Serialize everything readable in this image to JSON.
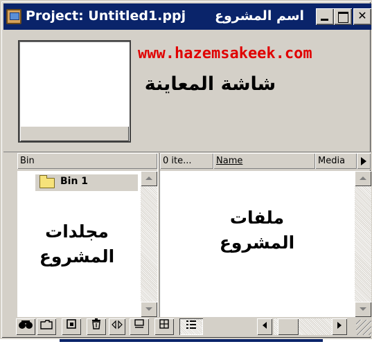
{
  "window": {
    "title": "Project: Untitled1.ppj",
    "title_annotation": "اسم المشروع",
    "buttons": {
      "close": "✕"
    }
  },
  "preview": {
    "watermark_url": "www.hazemsakeek.com",
    "label": "شاشة المعاينة"
  },
  "columns": {
    "bin": "Bin",
    "items": "0 ite...",
    "name": "Name",
    "media": "Media"
  },
  "bins": [
    {
      "label": "Bin 1"
    }
  ],
  "bin_pane_caption_line1": "مجلدات",
  "bin_pane_caption_line2": "المشروع",
  "files_pane_caption_line1": "ملفات",
  "files_pane_caption_line2": "المشروع",
  "toolbar": {
    "find_icon": "find-icon",
    "new_bin_icon": "folder-icon",
    "new_item_icon": "new-item-icon",
    "delete_icon": "trash-icon",
    "icon_view_icon": "icon-view-icon",
    "thumbnail_view_icon": "thumbnail-view-icon",
    "list_view_icon": "list-view-icon"
  },
  "colors": {
    "title_bar": "#0a246a",
    "annotation_red": "#e00000",
    "face": "#d4d0c8"
  }
}
